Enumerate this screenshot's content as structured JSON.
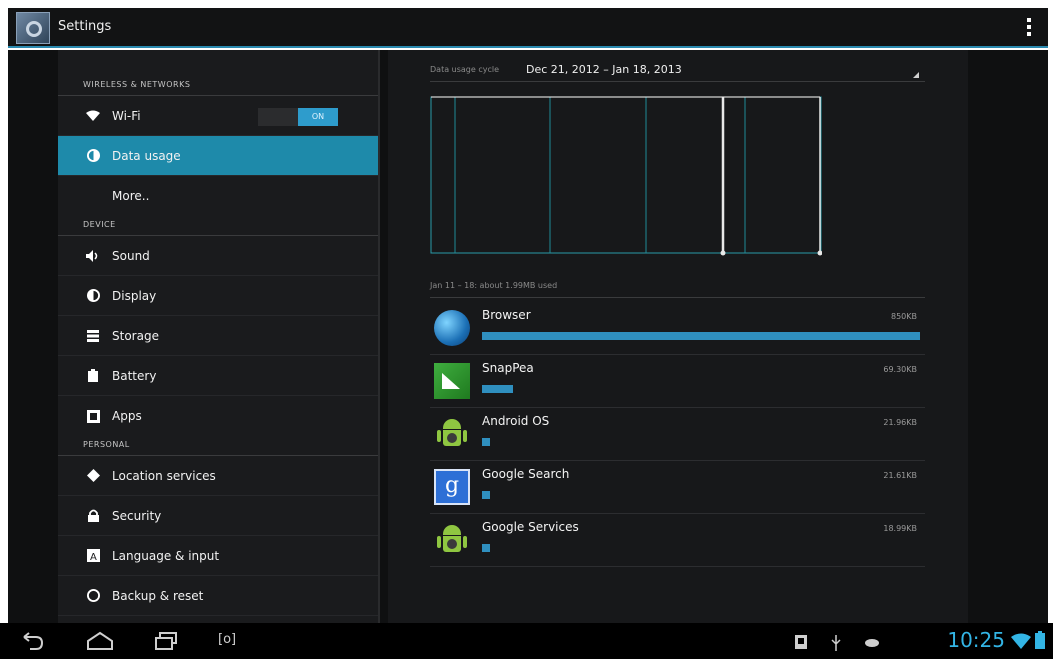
{
  "app": {
    "title": "Settings",
    "icon": "settings-gear-icon"
  },
  "sidebar": {
    "sections": [
      {
        "header": "WIRELESS & NETWORKS",
        "items": [
          {
            "label": "Wi-Fi",
            "icon": "wifi-icon",
            "toggle": "ON"
          },
          {
            "label": "Data usage",
            "icon": "data-usage-icon",
            "active": true
          },
          {
            "label": "More..",
            "icon": ""
          }
        ]
      },
      {
        "header": "DEVICE",
        "items": [
          {
            "label": "Sound",
            "icon": "speaker-icon"
          },
          {
            "label": "Display",
            "icon": "brightness-icon"
          },
          {
            "label": "Storage",
            "icon": "storage-icon"
          },
          {
            "label": "Battery",
            "icon": "battery-icon"
          },
          {
            "label": "Apps",
            "icon": "apps-icon"
          }
        ]
      },
      {
        "header": "PERSONAL",
        "items": [
          {
            "label": "Location services",
            "icon": "location-icon"
          },
          {
            "label": "Security",
            "icon": "lock-icon"
          },
          {
            "label": "Language & input",
            "icon": "keyboard-icon"
          },
          {
            "label": "Backup & reset",
            "icon": "backup-icon"
          }
        ]
      }
    ]
  },
  "content": {
    "cycle_label": "Data usage cycle",
    "cycle_value": "Dec 21, 2012 – Jan 18, 2013",
    "usage_summary": "Jan 11 – 18: about 1.99MB used",
    "apps": [
      {
        "name": "Browser",
        "size": "850KB",
        "icon": "browser-globe-icon",
        "fraction": 1.0
      },
      {
        "name": "SnapPea",
        "size": "69.30KB",
        "icon": "snappea-icon",
        "fraction": 0.071
      },
      {
        "name": "Android OS",
        "size": "21.96KB",
        "icon": "android-icon",
        "fraction": 0.018
      },
      {
        "name": "Google Search",
        "size": "21.61KB",
        "icon": "google-search-icon",
        "fraction": 0.018
      },
      {
        "name": "Google Services",
        "size": "18.99KB",
        "icon": "android-icon",
        "fraction": 0.018
      }
    ]
  },
  "system_bar": {
    "time": "10:25",
    "nav_icons": [
      "back-icon",
      "home-icon",
      "recent-apps-icon",
      "screenshot-icon"
    ],
    "status_icons": [
      "notification-icon",
      "usb-icon",
      "cloud-icon",
      "wifi-signal-icon",
      "battery-icon"
    ],
    "accent_color": "#33b5e5"
  },
  "colors": {
    "selection": "#1e8aaa",
    "usage_bar": "#2f8fbf",
    "chart_line": "#1fa0a8"
  }
}
